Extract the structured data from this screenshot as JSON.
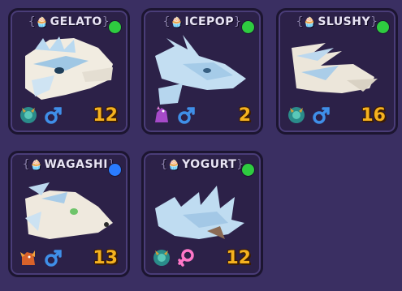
{
  "cards": [
    {
      "name": "GELATO",
      "level": "12",
      "gender": "male",
      "status_color": "#2ecc40",
      "pet_icon": "teal-dragon-icon"
    },
    {
      "name": "ICEPOP",
      "level": "2",
      "gender": "male",
      "status_color": "#2ecc40",
      "pet_icon": "purple-dinosaur-icon"
    },
    {
      "name": "SLUSHY",
      "level": "16",
      "gender": "male",
      "status_color": "#2ecc40",
      "pet_icon": "teal-dragon-icon"
    },
    {
      "name": "WAGASHI",
      "level": "13",
      "gender": "male",
      "status_color": "#2a7cff",
      "pet_icon": "orange-dragon-icon"
    },
    {
      "name": "YOGURT",
      "level": "12",
      "gender": "female",
      "status_color": "#2ecc40",
      "pet_icon": "teal-dragon-icon"
    }
  ],
  "title_prefix_icon": "cupcake-icon",
  "colors": {
    "background": "#3a2f62",
    "card": "#2c2148",
    "level_text": "#f5b21f",
    "male_symbol": "#3f8fe8",
    "female_symbol": "#ff77c8"
  }
}
